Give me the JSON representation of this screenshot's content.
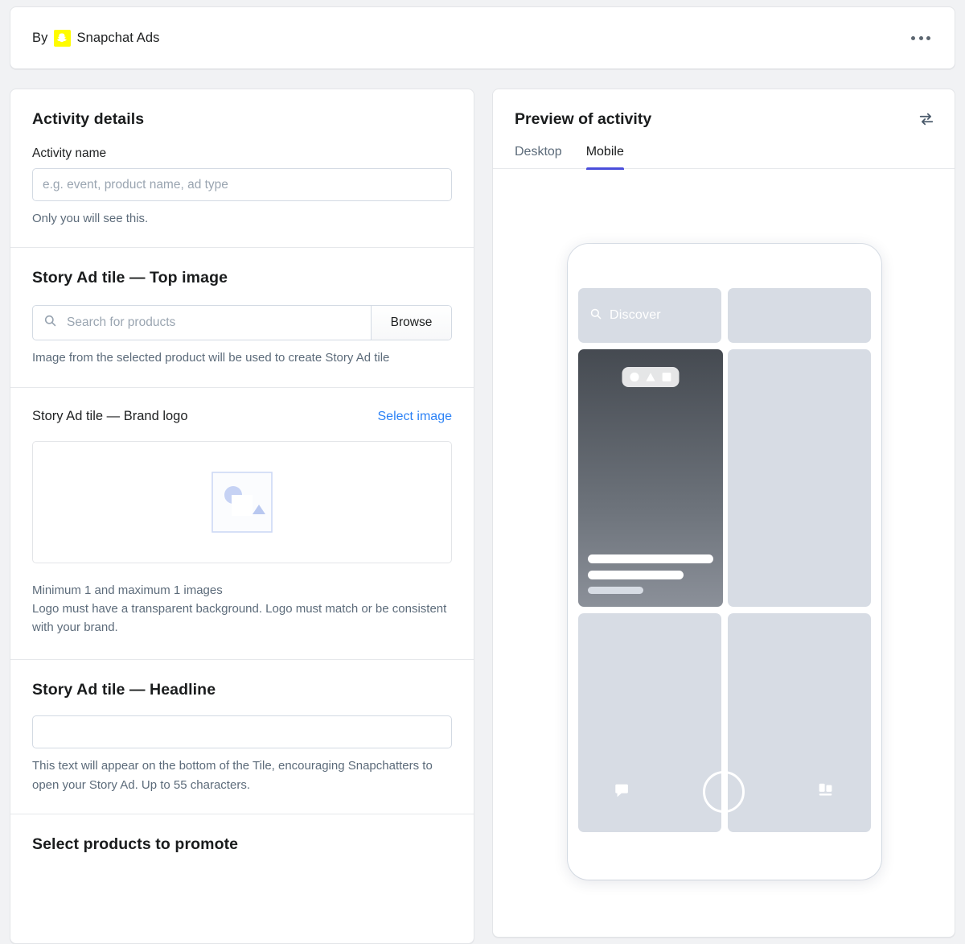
{
  "header": {
    "by_label": "By",
    "brand": "Snapchat Ads",
    "logo_icon": "snapchat-ghost-icon",
    "menu_icon": "ellipsis-horizontal-icon"
  },
  "activity_details": {
    "title": "Activity details",
    "name_label": "Activity name",
    "name_value": "",
    "name_placeholder": "e.g. event, product name, ad type",
    "name_helper": "Only you will see this."
  },
  "top_image": {
    "title": "Story Ad tile — Top image",
    "search_placeholder": "Search for products",
    "search_value": "",
    "search_icon": "search-icon",
    "browse_label": "Browse",
    "helper": "Image from the selected product will be used to create Story Ad tile"
  },
  "brand_logo": {
    "label": "Story Ad tile — Brand logo",
    "select_image_label": "Select image",
    "placeholder_icon": "image-placeholder-icon",
    "helper_line1": "Minimum 1 and maximum 1 images",
    "helper_line2": "Logo must have a transparent background. Logo must match or be consistent with your brand."
  },
  "headline": {
    "title": "Story Ad tile — Headline",
    "value": "",
    "placeholder": "",
    "helper": "This text will appear on the bottom of the Tile, encouraging Snapchatters to open your Story Ad. Up to 55 characters."
  },
  "products_section": {
    "title": "Select products to promote"
  },
  "preview": {
    "title": "Preview of activity",
    "swap_icon": "swap-arrows-icon",
    "tabs": [
      {
        "label": "Desktop",
        "active": false
      },
      {
        "label": "Mobile",
        "active": true
      }
    ],
    "mobile_mock": {
      "discover_label": "Discover",
      "discover_search_icon": "search-icon",
      "shape_badge_icons": [
        "circle-shape-icon",
        "triangle-shape-icon",
        "square-shape-icon"
      ],
      "nav_icons": [
        "chat-bubble-icon",
        "camera-circle-icon",
        "stories-cards-icon"
      ]
    }
  },
  "colors": {
    "brand_yellow": "#FFFC00",
    "accent_link": "#2c82f6",
    "tab_active_underline": "#4a4edb",
    "tile_gray": "#d7dce4",
    "page_bg": "#f1f2f4"
  }
}
